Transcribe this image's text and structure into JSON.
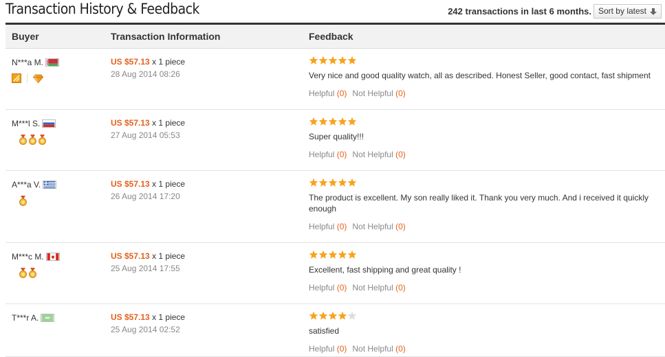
{
  "header": {
    "title": "Transaction History & Feedback",
    "count_text": "242 transactions in last 6 months.",
    "sort_label": "Sort by latest"
  },
  "columns": {
    "buyer": "Buyer",
    "transaction": "Transaction Information",
    "feedback": "Feedback"
  },
  "feedback_rows": [
    {
      "buyer": "N***a M.",
      "flag": "belarus-flag",
      "badges": [
        "level-square-icon",
        "diamond-icon"
      ],
      "price": "US $57.13",
      "qty": "x 1 piece",
      "date": "28 Aug 2014 08:26",
      "stars": 5,
      "text": "Very nice and good quality watch, all as described. Honest Seller, good contact, fast shipment",
      "helpful_label": "Helpful",
      "helpful_count": "(0)",
      "not_helpful_label": "Not Helpful",
      "not_helpful_count": "(0)"
    },
    {
      "buyer": "M***l S.",
      "flag": "russia-flag",
      "badges": [
        "medal-icon",
        "medal-icon",
        "medal-icon"
      ],
      "price": "US $57.13",
      "qty": "x 1 piece",
      "date": "27 Aug 2014 05:53",
      "stars": 5,
      "text": "Super quality!!!",
      "helpful_label": "Helpful",
      "helpful_count": "(0)",
      "not_helpful_label": "Not Helpful",
      "not_helpful_count": "(0)"
    },
    {
      "buyer": "A***a V.",
      "flag": "greece-flag",
      "badges": [
        "medal-icon"
      ],
      "price": "US $57.13",
      "qty": "x 1 piece",
      "date": "26 Aug 2014 17:20",
      "stars": 5,
      "text": "The product is excellent. My son really liked it. Thank you very much. And i received it quickly enough",
      "helpful_label": "Helpful",
      "helpful_count": "(0)",
      "not_helpful_label": "Not Helpful",
      "not_helpful_count": "(0)"
    },
    {
      "buyer": "M***c M.",
      "flag": "canada-flag",
      "badges": [
        "medal-icon",
        "medal-icon"
      ],
      "price": "US $57.13",
      "qty": "x 1 piece",
      "date": "25 Aug 2014 17:55",
      "stars": 5,
      "text": "Excellent, fast shipping and great quality !",
      "helpful_label": "Helpful",
      "helpful_count": "(0)",
      "not_helpful_label": "Not Helpful",
      "not_helpful_count": "(0)"
    },
    {
      "buyer": "T***r A.",
      "flag": "unknown-flag",
      "badges": [],
      "price": "US $57.13",
      "qty": "x 1 piece",
      "date": "25 Aug 2014 02:52",
      "stars": 4,
      "text": "satisfied",
      "helpful_label": "Helpful",
      "helpful_count": "(0)",
      "not_helpful_label": "Not Helpful",
      "not_helpful_count": "(0)"
    }
  ],
  "colors": {
    "price": "#e5611d",
    "star_filled": "#f7a31c",
    "star_empty": "#dddddd"
  }
}
